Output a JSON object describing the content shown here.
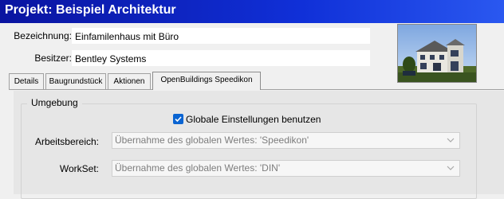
{
  "window": {
    "title": "Projekt: Beispiel Architektur"
  },
  "fields": {
    "bezeichnung_label": "Bezeichnung:",
    "bezeichnung_value": "Einfamilenhaus mit Büro",
    "besitzer_label": "Besitzer:",
    "besitzer_value": "Bentley Systems"
  },
  "tabs": [
    {
      "label": "Details"
    },
    {
      "label": "Baugrundstück"
    },
    {
      "label": "Aktionen"
    },
    {
      "label": "OpenBuildings Speedikon",
      "active": true
    }
  ],
  "group": {
    "title": "Umgebung",
    "checkbox_label": "Globale Einstellungen benutzen",
    "checkbox_checked": true,
    "arbeitsbereich_label": "Arbeitsbereich:",
    "arbeitsbereich_value": "Übernahme des globalen Wertes: 'Speedikon'",
    "workset_label": "WorkSet:",
    "workset_value": "Übernahme des globalen Wertes: 'DIN'"
  },
  "colors": {
    "titlebar": "#1030d8",
    "accent": "#0a64d2"
  },
  "icons": [
    "house-thumbnail",
    "checkmark-icon",
    "chevron-down-icon"
  ]
}
